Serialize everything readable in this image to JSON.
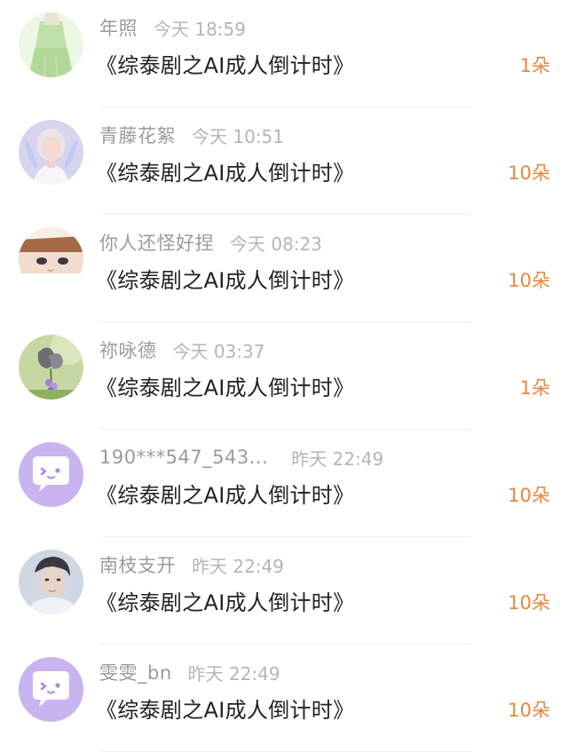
{
  "colors": {
    "gift": "#e8863a",
    "name": "#9b9b9b",
    "time": "#b5b5b5",
    "title": "#222222",
    "default_avatar_bg": "#c9b3f0"
  },
  "gifts": [
    {
      "name": "年照",
      "time": "今天 18:59",
      "title": "《综泰剧之AI成人倒计时》",
      "amount": "1朵",
      "avatar": "green-dress-photo"
    },
    {
      "name": "青藤花絮",
      "time": "今天 10:51",
      "title": "《综泰剧之AI成人倒计时》",
      "amount": "10朵",
      "avatar": "fairy-portrait-photo"
    },
    {
      "name": "你人还怪好捏",
      "time": "今天 08:23",
      "title": "《综泰剧之AI成人倒计时》",
      "amount": "10朵",
      "avatar": "anime-boy-photo"
    },
    {
      "name": "祢咏德",
      "time": "今天 03:37",
      "title": "《综泰剧之AI成人倒计时》",
      "amount": "1朵",
      "avatar": "butterfly-flower-photo"
    },
    {
      "name": "190***547_543...",
      "time": "昨天 22:49",
      "title": "《综泰剧之AI成人倒计时》",
      "amount": "10朵",
      "avatar": "default-chat-bubble-icon"
    },
    {
      "name": "南枝支开",
      "time": "昨天 22:49",
      "title": "《综泰剧之AI成人倒计时》",
      "amount": "10朵",
      "avatar": "man-portrait-photo"
    },
    {
      "name": "雯雯_bn",
      "time": "昨天 22:49",
      "title": "《综泰剧之AI成人倒计时》",
      "amount": "10朵",
      "avatar": "default-chat-bubble-icon"
    }
  ]
}
